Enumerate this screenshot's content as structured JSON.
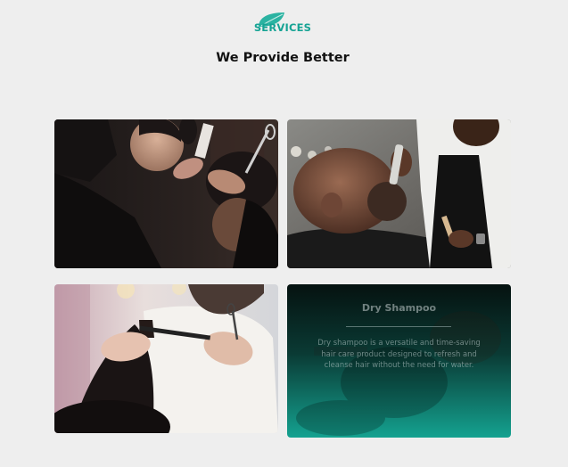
{
  "section": {
    "eyebrow": "SERVICES",
    "title": "We Provide Better",
    "accent_color": "#16a394"
  },
  "cards": [
    {
      "image": "barber-cutting-hair-photo"
    },
    {
      "image": "barber-trimming-beard-photo"
    },
    {
      "image": "stylist-cutting-long-hair-photo"
    },
    {
      "image": "barber-shop-photo-overlay",
      "title": "Dry Shampoo",
      "description": "Dry shampoo is a versatile and time-saving hair care product designed to refresh and cleanse hair without the need for water."
    }
  ]
}
